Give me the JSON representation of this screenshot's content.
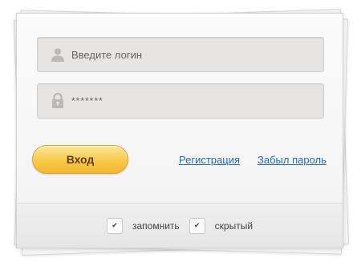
{
  "login_form": {
    "login_placeholder": "Введите логин",
    "password_value": "*******",
    "submit_label": "Вход",
    "register_link": "Регистрация",
    "forgot_link": "Забыл пароль"
  },
  "footer": {
    "remember_label": "запомнить",
    "hidden_label": "скрытый",
    "check_mark": "✔"
  },
  "icons": {
    "user": "user-icon",
    "lock": "lock-icon"
  },
  "colors": {
    "button_top": "#fde698",
    "button_bottom": "#f3b72e",
    "link": "#2a6aa8",
    "field_bg": "#e6e5e3"
  }
}
